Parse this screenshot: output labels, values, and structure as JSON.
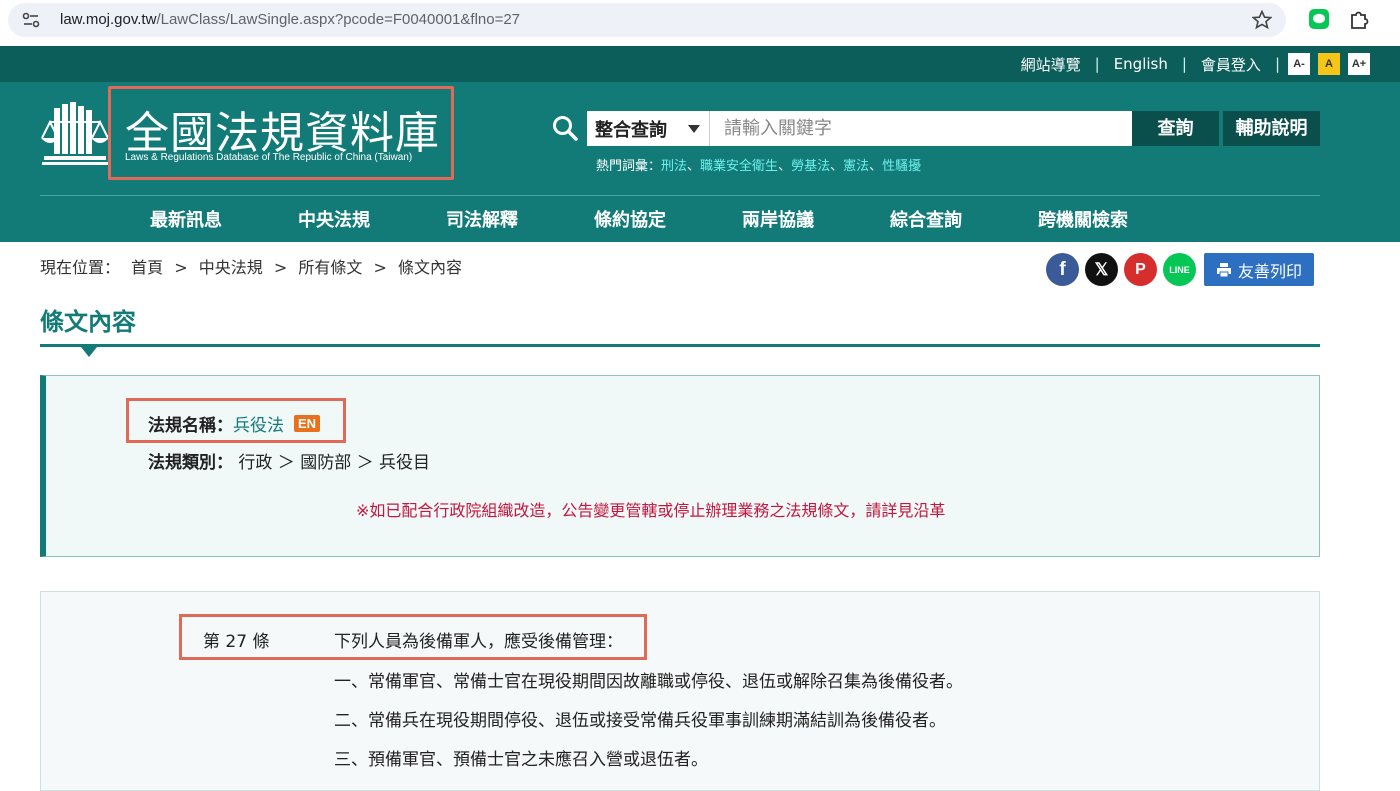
{
  "browser": {
    "url_host": "law.moj.gov.tw",
    "url_rest": "/LawClass/LawSingle.aspx?pcode=F0040001&flno=27"
  },
  "utility": {
    "sitemap": "網站導覽",
    "english": "English",
    "login": "會員登入",
    "font_small": "A-",
    "font_mid": "A",
    "font_large": "A+"
  },
  "logo": {
    "title": "全國法規資料庫",
    "subtitle": "Laws & Regulations Database of The Republic of China (Taiwan)"
  },
  "search": {
    "select_value": "整合查詢",
    "placeholder": "請輸入關鍵字",
    "query_label": "查詢",
    "help_label": "輔助說明",
    "hot_label": "熱門詞彙：",
    "hot_words": [
      "刑法",
      "職業安全衛生",
      "勞基法",
      "憲法",
      "性騷擾"
    ],
    "hot_sep": "、"
  },
  "nav": [
    "最新訊息",
    "中央法規",
    "司法解釋",
    "條約協定",
    "兩岸協議",
    "綜合查詢",
    "跨機關檢索"
  ],
  "breadcrumb": {
    "prefix": "現在位置：",
    "items": [
      "首頁",
      "中央法規",
      "所有條文",
      "條文內容"
    ],
    "sep": ">"
  },
  "share": {
    "fb": "f",
    "x": "𝕏",
    "p": "P",
    "line": "LINE",
    "print_label": "友善列印"
  },
  "page_title": "條文內容",
  "law": {
    "name_label": "法規名稱：",
    "name_value": "兵役法",
    "en_badge": "EN",
    "category_label": "法規類別：",
    "category_value": "行政 ＞ 國防部 ＞ 兵役目",
    "notice": "※如已配合行政院組織改造，公告變更管轄或停止辦理業務之法規條文，請詳見沿革"
  },
  "article": {
    "number": "第 27 條",
    "lines": [
      "下列人員為後備軍人，應受後備管理：",
      "一、常備軍官、常備士官在現役期間因故離職或停役、退伍或解除召集為後備役者。",
      "二、常備兵在現役期間停役、退伍或接受常備兵役軍事訓練期滿結訓為後備役者。",
      "三、預備軍官、預備士官之未應召入營或退伍者。"
    ]
  },
  "colors": {
    "brand_teal": "#127b78",
    "dark_teal": "#0b5e5a",
    "highlight": "#e06a58",
    "notice_red": "#c4163f"
  }
}
